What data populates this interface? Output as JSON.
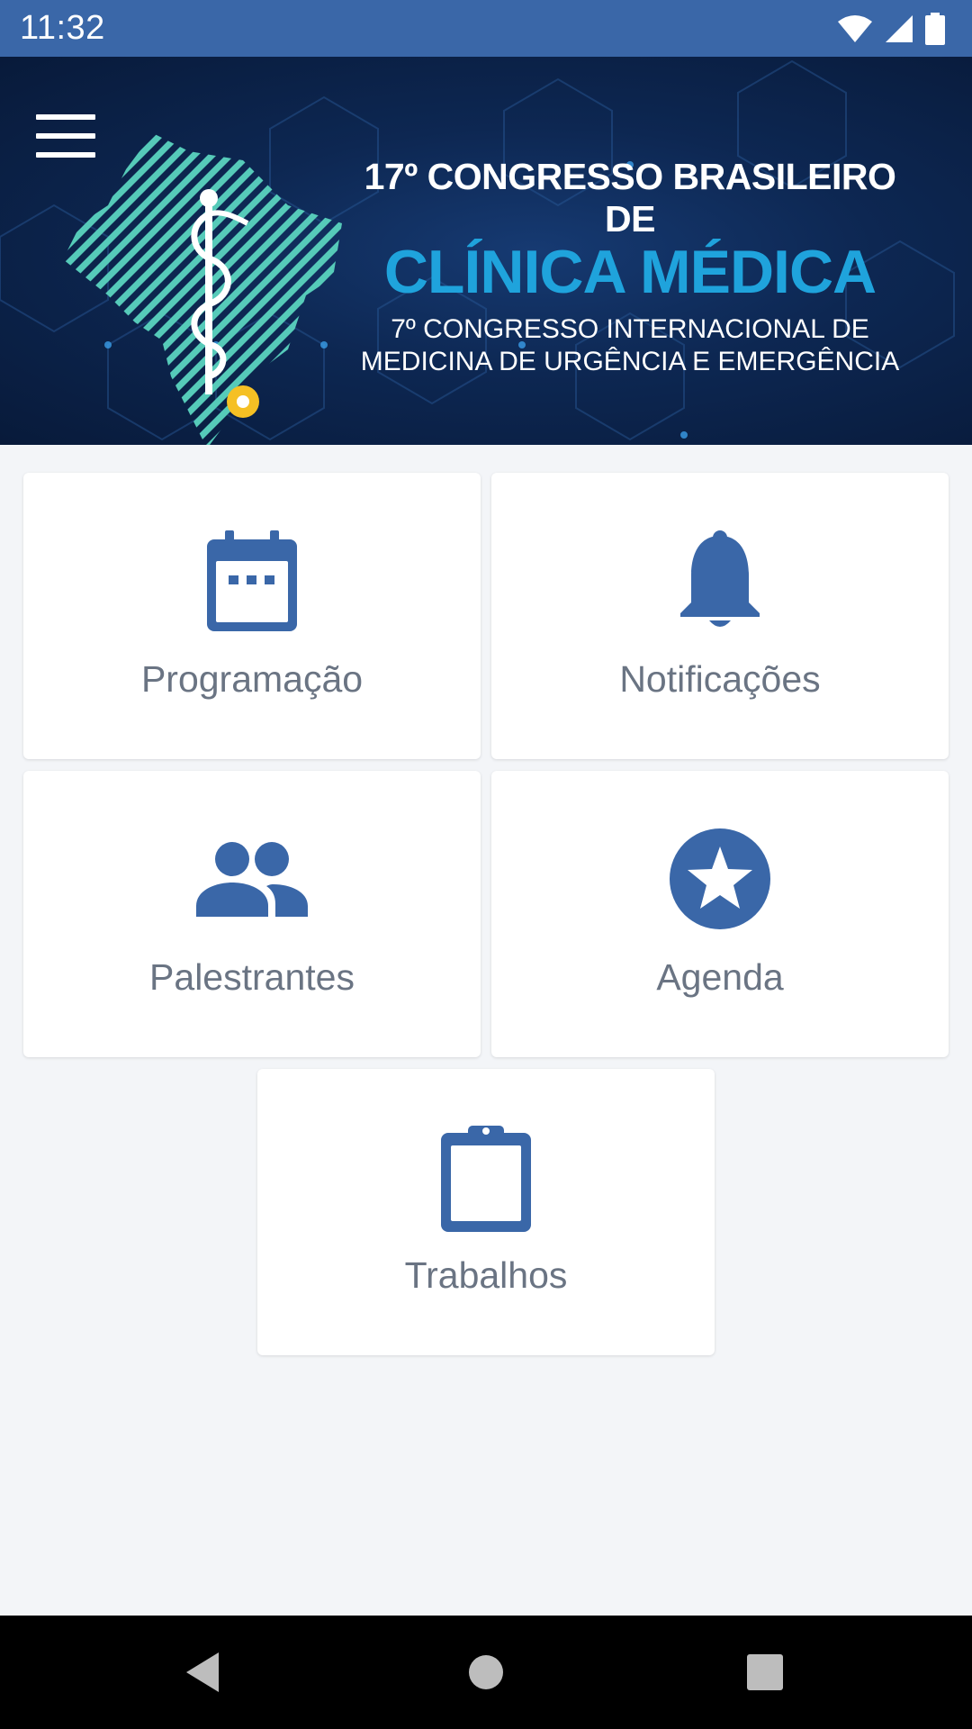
{
  "status_bar": {
    "time": "11:32",
    "icons": [
      "wifi-icon",
      "signal-icon",
      "battery-icon"
    ]
  },
  "banner": {
    "line1": "17º CONGRESSO BRASILEIRO DE",
    "line2": "CLÍNICA MÉDICA",
    "line3": "7º CONGRESSO INTERNACIONAL DE",
    "line4": "MEDICINA DE URGÊNCIA E EMERGÊNCIA"
  },
  "menu": [
    {
      "label": "Programação",
      "icon": "calendar-icon"
    },
    {
      "label": "Notificações",
      "icon": "bell-icon"
    },
    {
      "label": "Palestrantes",
      "icon": "people-icon"
    },
    {
      "label": "Agenda",
      "icon": "star-icon"
    },
    {
      "label": "Trabalhos",
      "icon": "clipboard-icon"
    }
  ],
  "nav_bar": {
    "buttons": [
      "back-icon",
      "home-icon",
      "recent-apps-icon"
    ]
  },
  "colors": {
    "accent": "#3a67a8",
    "banner_highlight": "#1fa3dc",
    "label": "#6a7483",
    "background": "#f3f5f8"
  }
}
